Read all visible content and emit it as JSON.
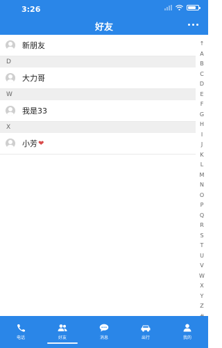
{
  "status_bar": {
    "time": "3:26"
  },
  "header": {
    "title": "好友"
  },
  "list": [
    {
      "type": "item",
      "name": "新朋友"
    },
    {
      "type": "section",
      "letter": "D"
    },
    {
      "type": "item",
      "name": "大力哥"
    },
    {
      "type": "section",
      "letter": "W"
    },
    {
      "type": "item",
      "name": "我是33"
    },
    {
      "type": "section",
      "letter": "X"
    },
    {
      "type": "item",
      "name": "小芳",
      "heart": true
    }
  ],
  "index_letters": [
    "↑",
    "A",
    "B",
    "C",
    "D",
    "E",
    "F",
    "G",
    "H",
    "I",
    "J",
    "K",
    "L",
    "M",
    "N",
    "O",
    "P",
    "Q",
    "R",
    "S",
    "T",
    "U",
    "V",
    "W",
    "X",
    "Y",
    "Z",
    "#"
  ],
  "tabs": [
    {
      "label": "电话",
      "icon": "phone-icon"
    },
    {
      "label": "好友",
      "icon": "friends-icon",
      "active": true
    },
    {
      "label": "消息",
      "icon": "message-icon"
    },
    {
      "label": "出行",
      "icon": "car-icon"
    },
    {
      "label": "我的",
      "icon": "profile-icon"
    }
  ],
  "colors": {
    "accent": "#2a86e8",
    "section_bg": "#efefef",
    "heart": "#d94a4a"
  }
}
